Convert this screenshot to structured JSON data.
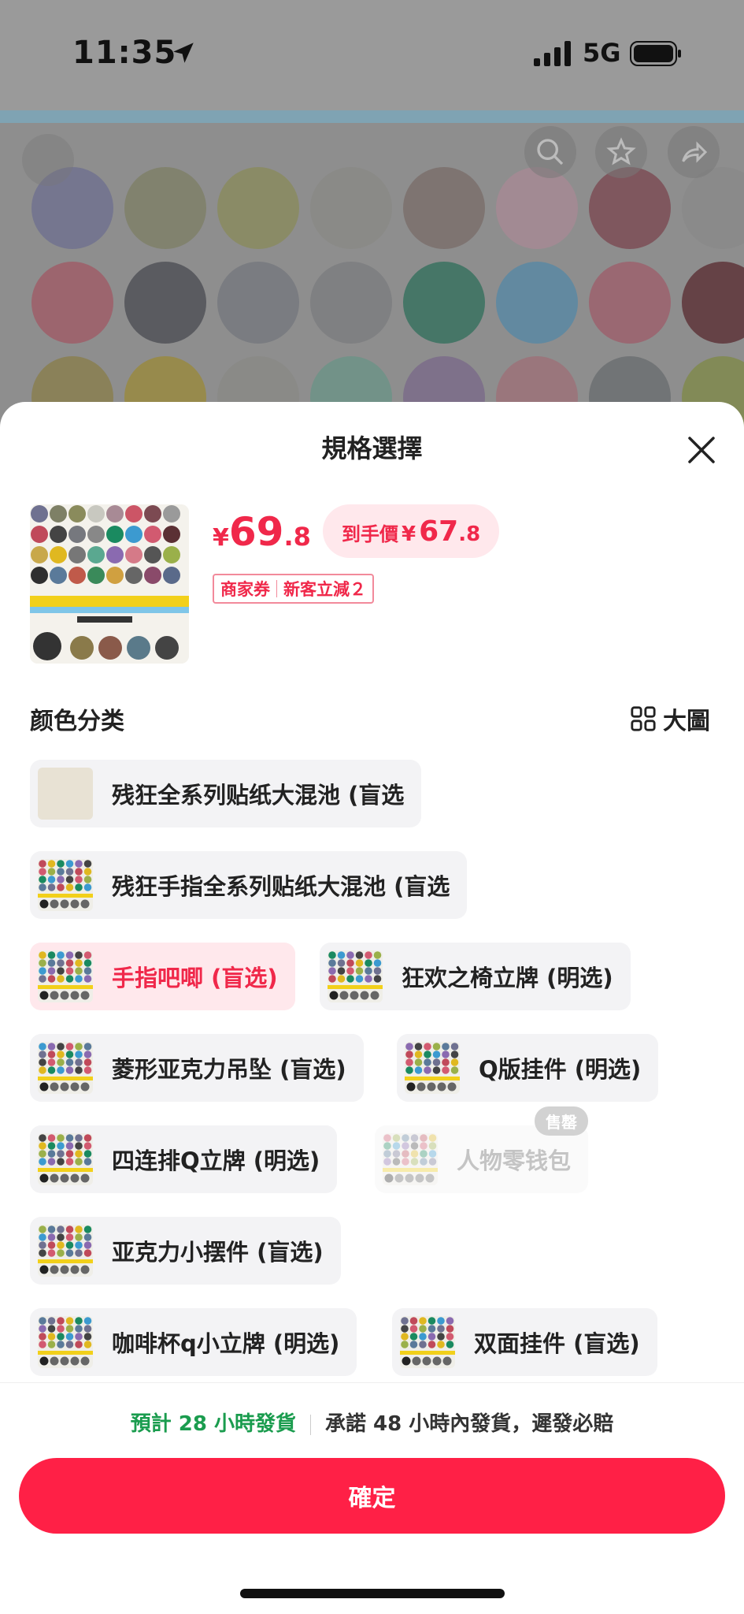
{
  "status_bar": {
    "time": "11:35",
    "network": "5G"
  },
  "sheet": {
    "title": "規格選擇",
    "price": {
      "yen": "¥",
      "int": "69",
      "dec": ".8"
    },
    "final_price": {
      "label": "到手價",
      "yen": "¥",
      "int": "67",
      "dec": ".8"
    },
    "coupon": {
      "part1": "商家券",
      "part2": "新客立減２"
    },
    "section_label": "颜色分类",
    "big_view_label": "大圖",
    "options": [
      {
        "label": "残狂全系列贴纸大混池 (盲选",
        "state": "normal"
      },
      {
        "label": "残狂手指全系列贴纸大混池 (盲选",
        "state": "normal"
      },
      {
        "label": "手指吧唧 (盲选)",
        "state": "selected"
      },
      {
        "label": "狂欢之椅立牌 (明选)",
        "state": "normal"
      },
      {
        "label": "菱形亚克力吊坠 (盲选)",
        "state": "normal"
      },
      {
        "label": "Q版挂件 (明选)",
        "state": "normal"
      },
      {
        "label": "四连排Q立牌 (明选)",
        "state": "normal"
      },
      {
        "label": "人物零钱包",
        "state": "disabled",
        "badge": "售罄"
      },
      {
        "label": "亚克力小摆件 (盲选)",
        "state": "normal"
      },
      {
        "label": "咖啡杯q小立牌 (明选)",
        "state": "normal"
      },
      {
        "label": "双面挂件 (盲选)",
        "state": "normal"
      }
    ],
    "shipping": {
      "estimate": "預計 28 小時發貨",
      "promise": "承諾 48 小時內發貨，遲發必賠"
    },
    "confirm_label": "確定"
  },
  "colors": {
    "accent": "#ff2046",
    "price": "#f0284a",
    "green": "#1a9c4e"
  }
}
